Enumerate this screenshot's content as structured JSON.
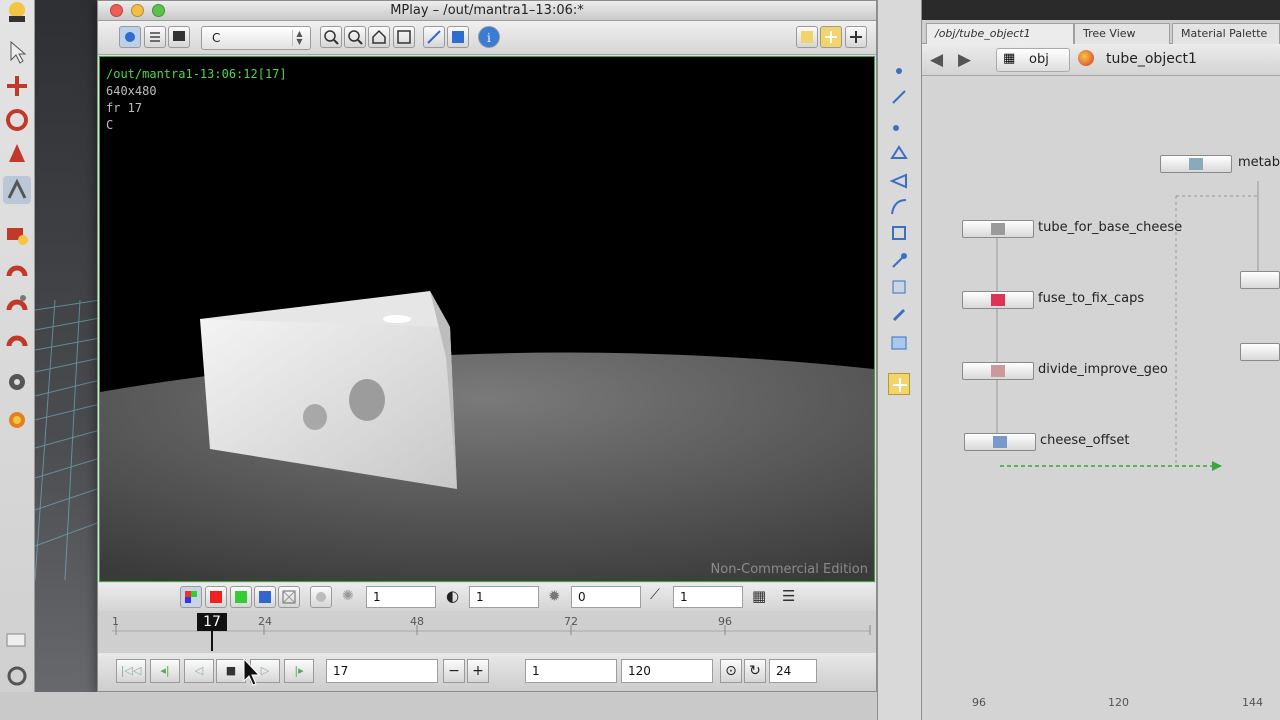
{
  "window": {
    "title": "MPlay – /out/mantra1–13:06:*",
    "channel": "C"
  },
  "image_info": {
    "path": "/out/mantra1-13:06:12[17]",
    "resolution": "640x480",
    "frame": "fr 17",
    "channel": "C"
  },
  "watermark": "Non-Commercial Edition",
  "display_controls": {
    "gamma_value": "1",
    "exposure_value": "1",
    "brightness_value": "0",
    "lut_value": "1"
  },
  "timeline": {
    "current_frame": "17",
    "ticks": [
      "1",
      "24",
      "48",
      "72",
      "96"
    ]
  },
  "playbar": {
    "frame_field": "17",
    "minus_label": "−",
    "plus_label": "+",
    "start_frame": "1",
    "end_frame": "120",
    "fps": "24"
  },
  "network": {
    "tabs": [
      "/obj/tube_object1",
      "Tree View",
      "Material Palette"
    ],
    "path_root": "obj",
    "path_object": "tube_object1",
    "nodes": [
      {
        "name": "tube_for_base_cheese"
      },
      {
        "name": "fuse_to_fix_caps"
      },
      {
        "name": "divide_improve_geo"
      },
      {
        "name": "cheese_offset"
      },
      {
        "name": "metab"
      }
    ],
    "ruler": [
      "96",
      "120",
      "144"
    ]
  },
  "colors": {
    "accent_green": "#3da53d",
    "render_bg": "#000000",
    "info_green": "#4fd64f"
  }
}
